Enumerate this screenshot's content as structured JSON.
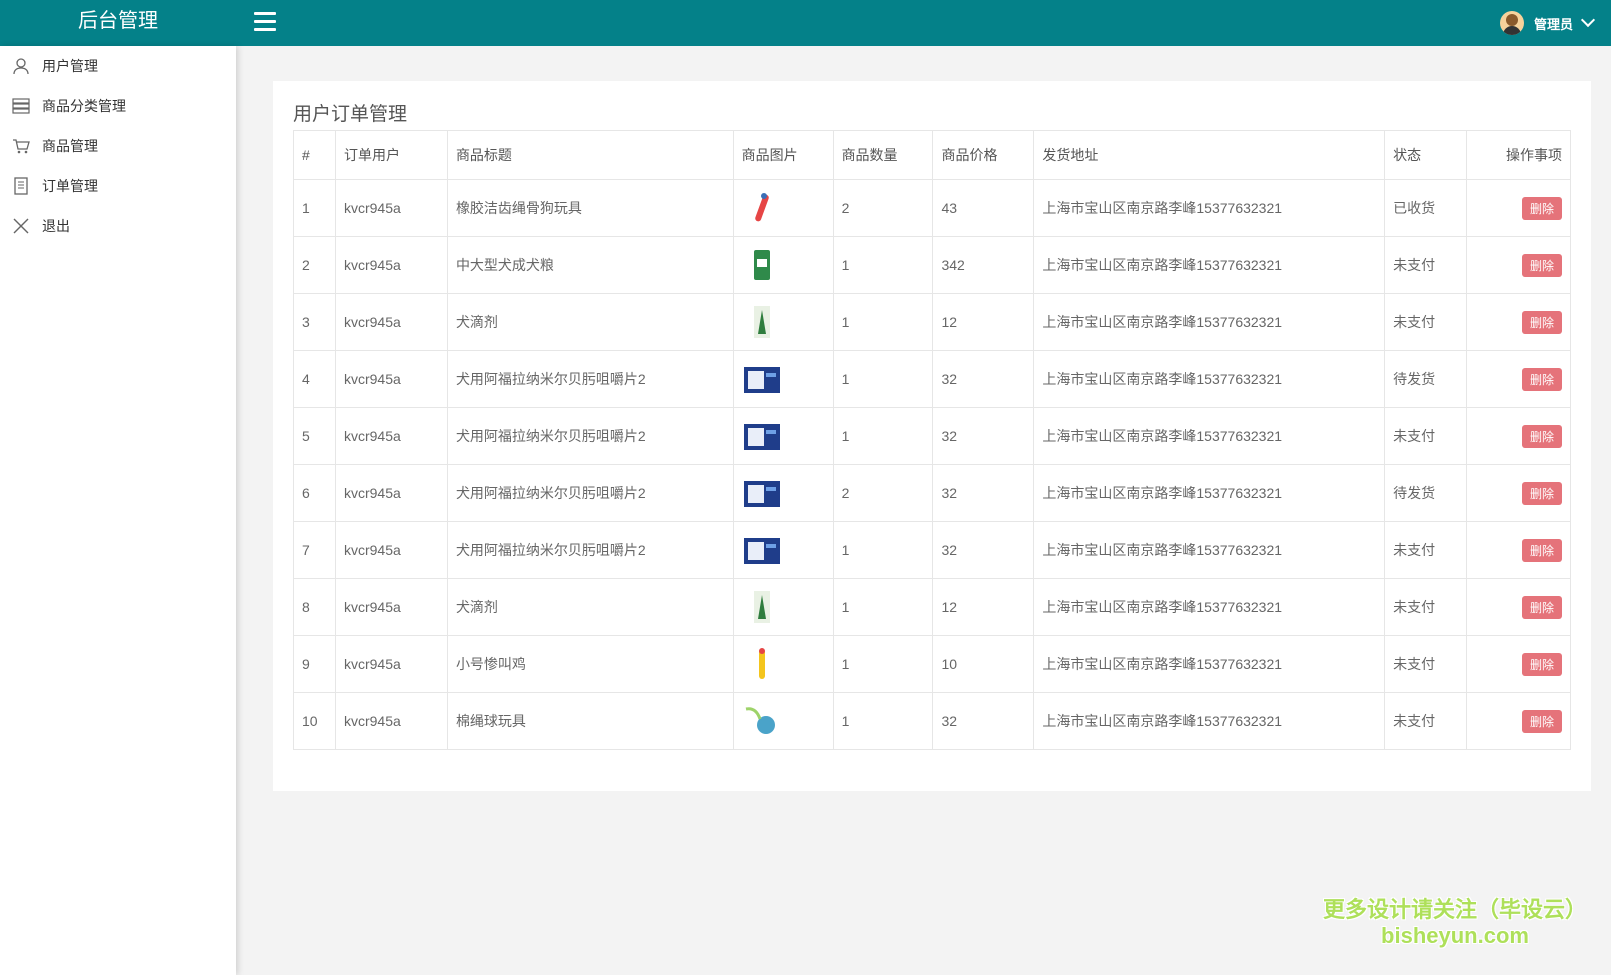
{
  "header": {
    "brand": "后台管理",
    "user": "管理员"
  },
  "sidebar": {
    "items": [
      {
        "label": "用户管理",
        "icon": "user-icon"
      },
      {
        "label": "商品分类管理",
        "icon": "list-icon"
      },
      {
        "label": "商品管理",
        "icon": "cart-icon"
      },
      {
        "label": "订单管理",
        "icon": "document-icon"
      },
      {
        "label": "退出",
        "icon": "close-icon"
      }
    ]
  },
  "main": {
    "title": "用户订单管理",
    "columns": [
      "#",
      "订单用户",
      "商品标题",
      "商品图片",
      "商品数量",
      "商品价格",
      "发货地址",
      "状态",
      "操作事项"
    ],
    "rows": [
      {
        "id": "1",
        "user": "kvcr945a",
        "title": "橡胶洁齿绳骨狗玩具",
        "image": "rope-bone-toy",
        "qty": "2",
        "price": "43",
        "address": "上海市宝山区南京路李峰15377632321",
        "status": "已收货",
        "action": "删除"
      },
      {
        "id": "2",
        "user": "kvcr945a",
        "title": "中大型犬成犬粮",
        "image": "dog-food-bag",
        "qty": "1",
        "price": "342",
        "address": "上海市宝山区南京路李峰15377632321",
        "status": "未支付",
        "action": "删除"
      },
      {
        "id": "3",
        "user": "kvcr945a",
        "title": "犬滴剂",
        "image": "drops-bottle",
        "qty": "1",
        "price": "12",
        "address": "上海市宝山区南京路李峰15377632321",
        "status": "未支付",
        "action": "删除"
      },
      {
        "id": "4",
        "user": "kvcr945a",
        "title": "犬用阿福拉纳米尔贝肟咀嚼片2",
        "image": "chewable-box",
        "qty": "1",
        "price": "32",
        "address": "上海市宝山区南京路李峰15377632321",
        "status": "待发货",
        "action": "删除"
      },
      {
        "id": "5",
        "user": "kvcr945a",
        "title": "犬用阿福拉纳米尔贝肟咀嚼片2",
        "image": "chewable-box",
        "qty": "1",
        "price": "32",
        "address": "上海市宝山区南京路李峰15377632321",
        "status": "未支付",
        "action": "删除"
      },
      {
        "id": "6",
        "user": "kvcr945a",
        "title": "犬用阿福拉纳米尔贝肟咀嚼片2",
        "image": "chewable-box",
        "qty": "2",
        "price": "32",
        "address": "上海市宝山区南京路李峰15377632321",
        "status": "待发货",
        "action": "删除"
      },
      {
        "id": "7",
        "user": "kvcr945a",
        "title": "犬用阿福拉纳米尔贝肟咀嚼片2",
        "image": "chewable-box",
        "qty": "1",
        "price": "32",
        "address": "上海市宝山区南京路李峰15377632321",
        "status": "未支付",
        "action": "删除"
      },
      {
        "id": "8",
        "user": "kvcr945a",
        "title": "犬滴剂",
        "image": "drops-bottle",
        "qty": "1",
        "price": "12",
        "address": "上海市宝山区南京路李峰15377632321",
        "status": "未支付",
        "action": "删除"
      },
      {
        "id": "9",
        "user": "kvcr945a",
        "title": "小号惨叫鸡",
        "image": "squeaky-chicken",
        "qty": "1",
        "price": "10",
        "address": "上海市宝山区南京路李峰15377632321",
        "status": "未支付",
        "action": "删除"
      },
      {
        "id": "10",
        "user": "kvcr945a",
        "title": "棉绳球玩具",
        "image": "rope-ball",
        "qty": "1",
        "price": "32",
        "address": "上海市宝山区南京路李峰15377632321",
        "status": "未支付",
        "action": "删除"
      }
    ]
  },
  "watermark": {
    "line1": "更多设计请关注（毕设云）",
    "line2": "bisheyun.com"
  },
  "colors": {
    "header": "#048189",
    "danger": "#e5737a"
  }
}
